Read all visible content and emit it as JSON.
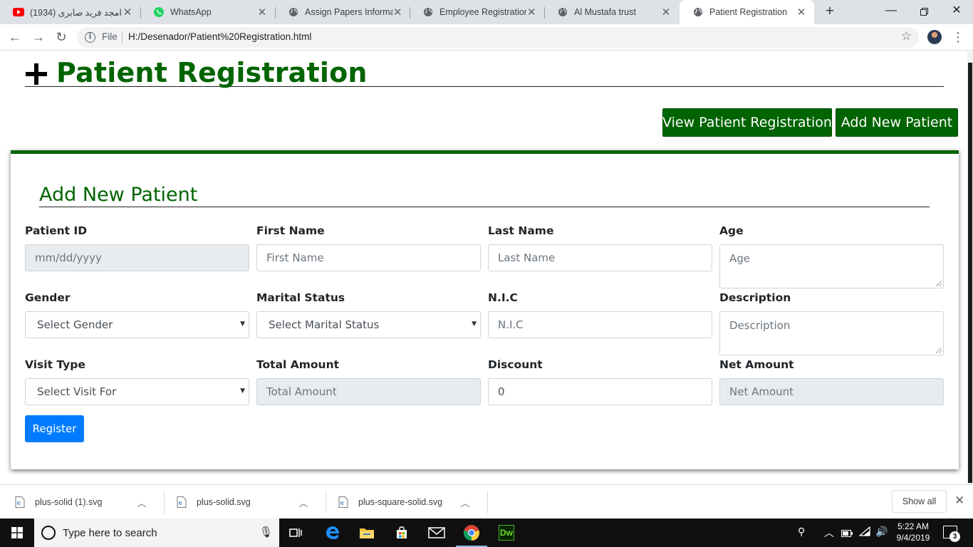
{
  "browser": {
    "tabs": [
      {
        "title": "(1934) امجد فرید صابری",
        "icon": "youtube-icon",
        "active": false
      },
      {
        "title": "WhatsApp",
        "icon": "whatsapp-icon",
        "active": false
      },
      {
        "title": "Assign Papers Information",
        "icon": "globe-icon",
        "active": false
      },
      {
        "title": "Employee Registration",
        "icon": "globe-icon",
        "active": false
      },
      {
        "title": "Al Mustafa trust",
        "icon": "globe-icon",
        "active": false
      },
      {
        "title": "Patient Registration",
        "icon": "globe-icon",
        "active": true
      }
    ],
    "address": {
      "scheme_label": "File",
      "url": "H:/Desenador/Patient%20Registration.html"
    }
  },
  "page": {
    "title": "Patient Registration",
    "buttons": {
      "view": "View Patient Registration",
      "add": "Add New Patient"
    },
    "form": {
      "title": "Add New Patient",
      "fields": {
        "patient_id": {
          "label": "Patient ID",
          "placeholder": "mm/dd/yyyy"
        },
        "first_name": {
          "label": "First Name",
          "placeholder": "First Name"
        },
        "last_name": {
          "label": "Last Name",
          "placeholder": "Last Name"
        },
        "age": {
          "label": "Age",
          "placeholder": "Age"
        },
        "gender": {
          "label": "Gender",
          "selected": "Select Gender"
        },
        "marital_status": {
          "label": "Marital Status",
          "selected": "Select Marital Status"
        },
        "nic": {
          "label": "N.I.C",
          "placeholder": "N.I.C"
        },
        "description": {
          "label": "Description",
          "placeholder": "Description"
        },
        "visit_type": {
          "label": "Visit Type",
          "selected": "Select Visit For"
        },
        "total_amount": {
          "label": "Total Amount",
          "placeholder": "Total Amount"
        },
        "discount": {
          "label": "Discount",
          "value": "0"
        },
        "net_amount": {
          "label": "Net Amount",
          "placeholder": "Net Amount"
        }
      },
      "submit_label": "Register"
    }
  },
  "downloads": {
    "items": [
      "plus-solid (1).svg",
      "plus-solid.svg",
      "plus-square-solid.svg"
    ],
    "show_all": "Show all"
  },
  "taskbar": {
    "search_placeholder": "Type here to search",
    "time": "5:22 AM",
    "date": "9/4/2019",
    "notifications": "3",
    "dreamweaver_label": "Dw"
  },
  "colors": {
    "brand_green": "#006400",
    "primary_blue": "#007bff",
    "disabled_gray": "#e9ecef"
  }
}
